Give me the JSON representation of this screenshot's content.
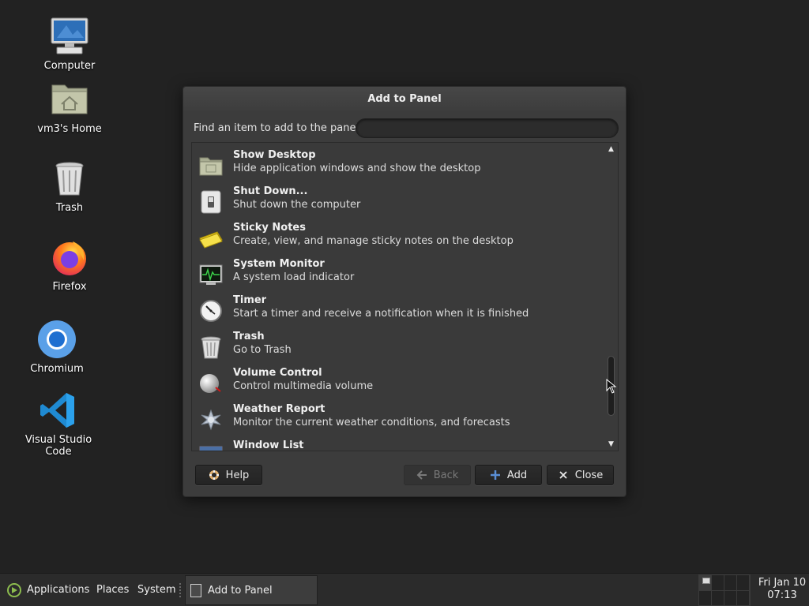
{
  "desktop": {
    "icons": [
      {
        "label": "Computer",
        "icon": "computer-icon"
      },
      {
        "label": "vm3's Home",
        "icon": "home-folder-icon"
      },
      {
        "label": "Trash",
        "icon": "trash-icon"
      },
      {
        "label": "Firefox",
        "icon": "firefox-icon"
      },
      {
        "label": "Chromium",
        "icon": "chromium-icon"
      },
      {
        "label": "Visual Studio Code",
        "icon": "vscode-icon"
      }
    ]
  },
  "dialog": {
    "title": "Add to Panel",
    "search_label": "Find an item to add to the panel:",
    "search_value": "",
    "items": [
      {
        "title": "Show Desktop",
        "desc": "Hide application windows and show the desktop",
        "icon": "show-desktop-icon"
      },
      {
        "title": "Shut Down...",
        "desc": "Shut down the computer",
        "icon": "shutdown-icon"
      },
      {
        "title": "Sticky Notes",
        "desc": "Create, view, and manage sticky notes on the desktop",
        "icon": "sticky-notes-icon"
      },
      {
        "title": "System Monitor",
        "desc": "A system load indicator",
        "icon": "system-monitor-icon"
      },
      {
        "title": "Timer",
        "desc": "Start a timer and receive a notification when it is finished",
        "icon": "timer-icon"
      },
      {
        "title": "Trash",
        "desc": "Go to Trash",
        "icon": "trash-icon"
      },
      {
        "title": "Volume Control",
        "desc": "Control multimedia volume",
        "icon": "volume-icon"
      },
      {
        "title": "Weather Report",
        "desc": "Monitor the current weather conditions, and forecasts",
        "icon": "weather-icon"
      },
      {
        "title": "Window List",
        "desc": "",
        "icon": "window-list-icon"
      }
    ],
    "buttons": {
      "help": "Help",
      "back": "Back",
      "add": "Add",
      "close": "Close"
    }
  },
  "taskbar": {
    "menus": [
      "Applications",
      "Places",
      "System"
    ],
    "active_window": "Add to Panel",
    "clock_date": "Fri Jan 10",
    "clock_time": "07:13"
  }
}
